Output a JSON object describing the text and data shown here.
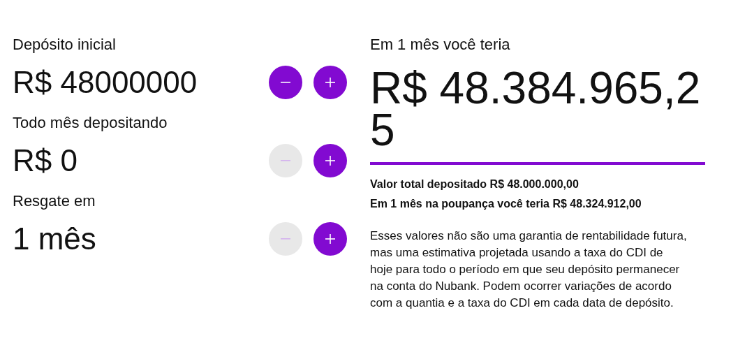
{
  "inputs": [
    {
      "label": "Depósito inicial",
      "value": "R$ 48000000",
      "decrease_disabled": false,
      "increase_disabled": false
    },
    {
      "label": "Todo mês depositando",
      "value": "R$ 0",
      "decrease_disabled": true,
      "increase_disabled": false
    },
    {
      "label": "Resgate em",
      "value": "1  mês",
      "decrease_disabled": true,
      "increase_disabled": false
    }
  ],
  "result": {
    "heading": "Em 1 mês você teria",
    "amount": "R$ 48.384.965,25",
    "summary": [
      "Valor total depositado R$ 48.000.000,00",
      "Em 1 mês na poupança você teria R$ 48.324.912,00"
    ],
    "disclaimer": "Esses valores não são uma garantia de rentabilidade futura, mas uma estimativa projetada usando a taxa do CDI de hoje para todo o período em que seu depósito permanecer na conta do Nubank. Podem ocorrer variações de acordo com a quantia e a taxa do CDI em cada data de depósito."
  }
}
